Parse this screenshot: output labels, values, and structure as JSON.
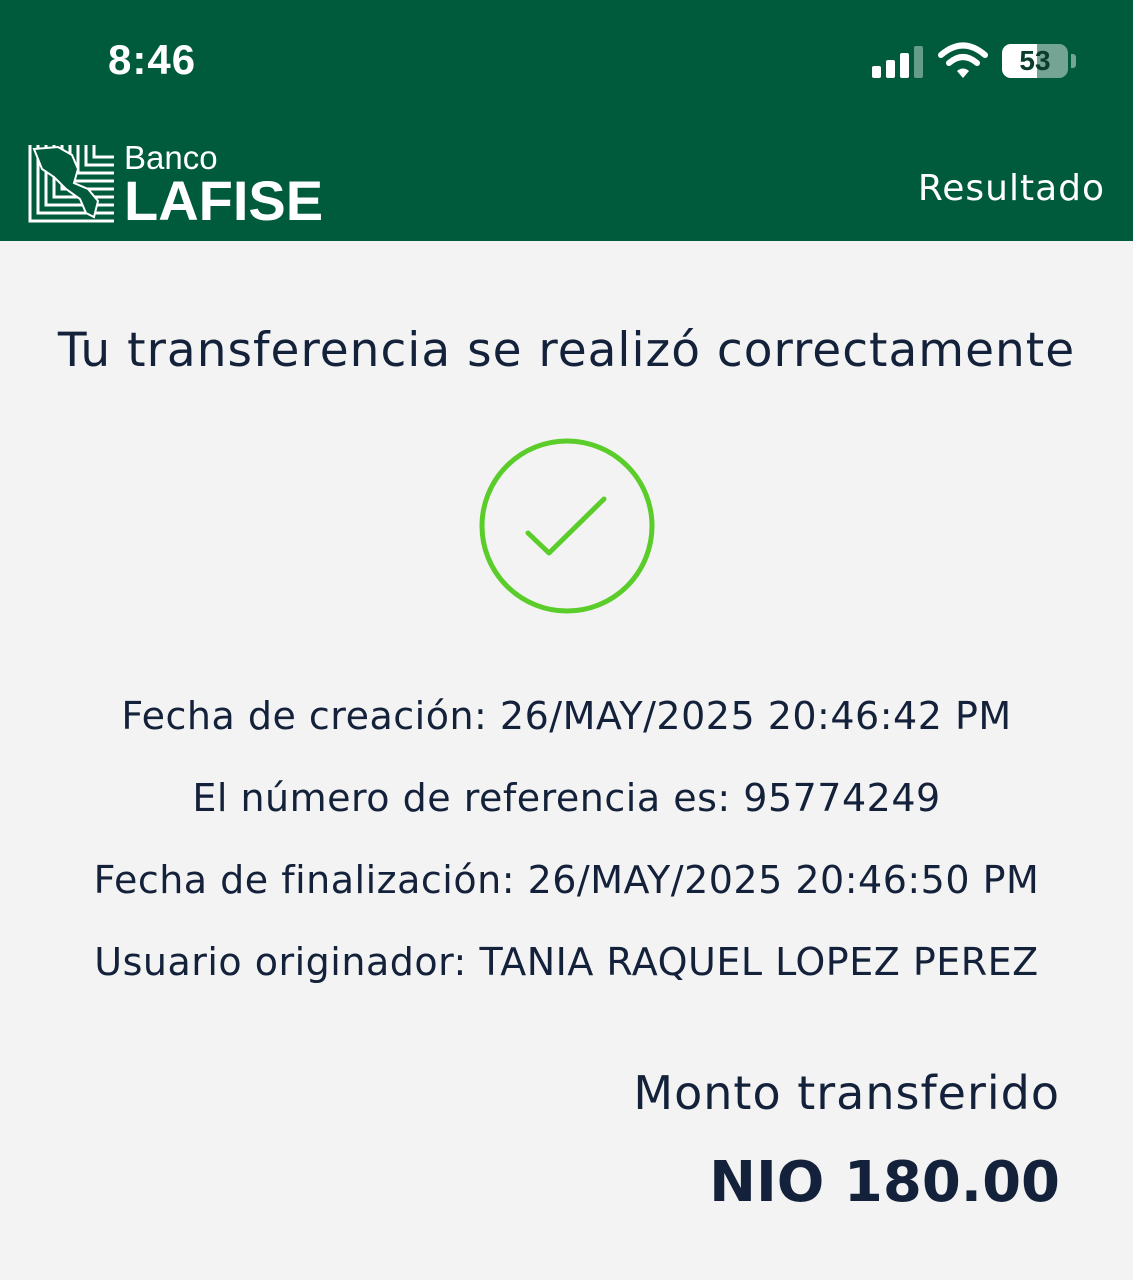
{
  "status_bar": {
    "time": "8:46",
    "battery_level": "53",
    "battery_fraction": 0.53,
    "signal_icon": "cellular-signal-icon",
    "wifi_icon": "wifi-icon"
  },
  "header": {
    "brand_small": "Banco",
    "brand_big": "LAFISE",
    "title": "Resultado",
    "logo_icon": "lafise-logo-icon",
    "background_color": "#005a3c"
  },
  "result": {
    "message": "Tu transferencia se realizó correctamente",
    "status_icon": "check-circle-icon",
    "accent_color": "#5acd2a"
  },
  "details": [
    "Fecha de creación: 26/MAY/2025 20:46:42 PM",
    "El número de referencia es: 95774249",
    "Fecha de finalización: 26/MAY/2025 20:46:50 PM",
    "Usuario originador: TANIA RAQUEL LOPEZ PEREZ"
  ],
  "amount": {
    "label": "Monto transferido",
    "value": "NIO 180.00"
  }
}
